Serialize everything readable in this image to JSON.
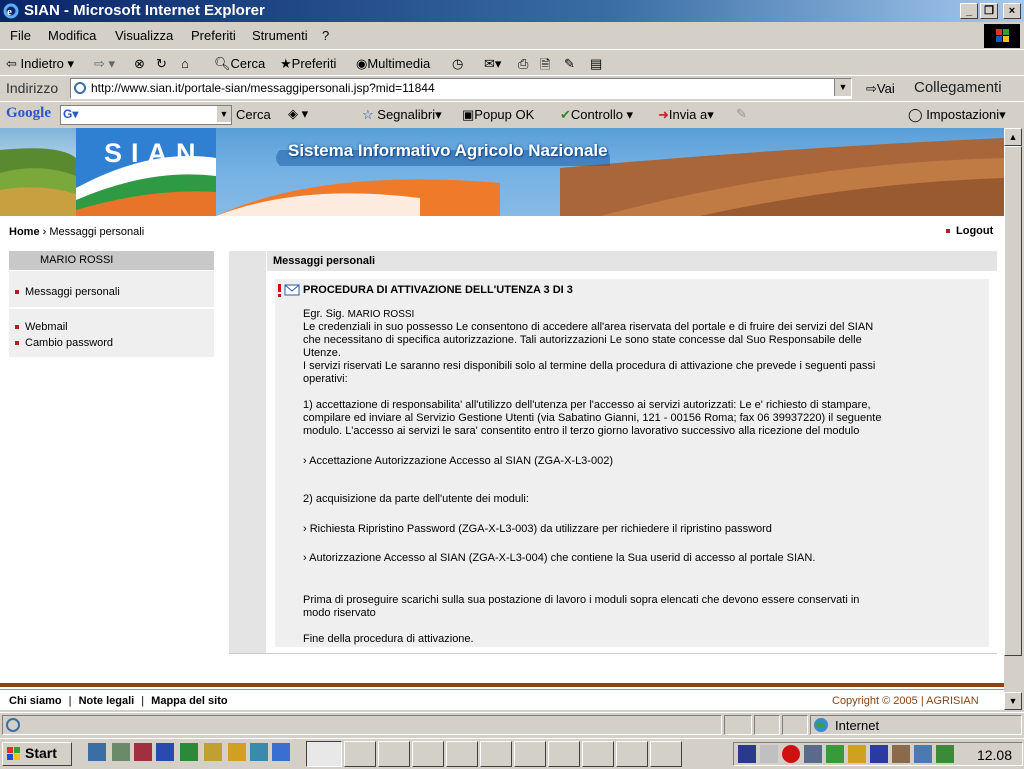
{
  "window": {
    "title": "SIAN - Microsoft Internet Explorer"
  },
  "menu": [
    "File",
    "Modifica",
    "Visualizza",
    "Preferiti",
    "Strumenti",
    "?"
  ],
  "toolbar": {
    "back": "Indietro",
    "search": "Cerca",
    "favorites": "Preferiti",
    "media": "Multimedia"
  },
  "address": {
    "label": "Indirizzo",
    "url": "http://www.sian.it/portale-sian/messaggipersonali.jsp?mid=11844",
    "go": "Vai",
    "links": "Collegamenti"
  },
  "googlebar": {
    "brand": "Google",
    "search": "Cerca",
    "bookmarks": "Segnalibri",
    "popup": "Popup OK",
    "check": "Controllo",
    "send": "Invia a",
    "settings": "Impostazioni"
  },
  "banner": {
    "logo": "SIAN",
    "title": "Sistema Informativo Agricolo Nazionale"
  },
  "breadcrumb": {
    "home": "Home",
    "current": "Messaggi personali"
  },
  "logout": "Logout",
  "sidebar": {
    "user": "MARIO ROSSI",
    "items": [
      "Messaggi personali",
      "Webmail",
      "Cambio password"
    ]
  },
  "main": {
    "heading": "Messaggi personali",
    "message": {
      "title": "PROCEDURA DI ATTIVAZIONE DELL'UTENZA 3 DI 3",
      "greeting": "Egr. Sig.",
      "name": "MARIO ROSSI",
      "lines": [
        "Le credenziali in suo possesso Le consentono di accedere all'area riservata del portale e di fruire dei servizi del SIAN",
        "che necessitano di specifica autorizzazione. Tali autorizzazioni Le sono state concesse dal Suo Responsabile delle",
        "Utenze.",
        "I servizi riservati Le saranno resi disponibili solo al termine della procedura di attivazione che prevede i seguenti passi",
        "operativi:"
      ],
      "step1": [
        "1) accettazione di responsabilita' all'utilizzo dell'utenza per l'accesso ai servizi autorizzati: Le e' richiesto di stampare,",
        "compilare ed inviare al Servizio Gestione Utenti (via Sabatino Gianni, 121 - 00156 Roma; fax 06 39937220) il seguente",
        "modulo. L'accesso ai servizi le sara' consentito entro il terzo giorno lavorativo successivo alla ricezione del modulo"
      ],
      "link1": "Accettazione Autorizzazione Accesso al SIAN (ZGA-X-L3-002)",
      "step2": "2) acquisizione da parte dell'utente dei moduli:",
      "link2": "Richiesta Ripristino Password (ZGA-X-L3-003) da utilizzare per richiedere il ripristino password",
      "link3": "Autorizzazione Accesso al SIAN (ZGA-X-L3-004) che contiene la Sua userid di accesso al portale SIAN.",
      "final": [
        "Prima di proseguire scarichi sulla sua postazione di lavoro i moduli sopra elencati che devono essere conservati in",
        "modo riservato"
      ],
      "end": "Fine della procedura di attivazione."
    }
  },
  "footer": {
    "links": [
      "Chi siamo",
      "Note legali",
      "Mappa del sito"
    ],
    "copyright": "Copyright © 2005 | AGRISIAN"
  },
  "status": {
    "zone": "Internet"
  },
  "taskbar": {
    "start": "Start",
    "clock": "12.08"
  }
}
